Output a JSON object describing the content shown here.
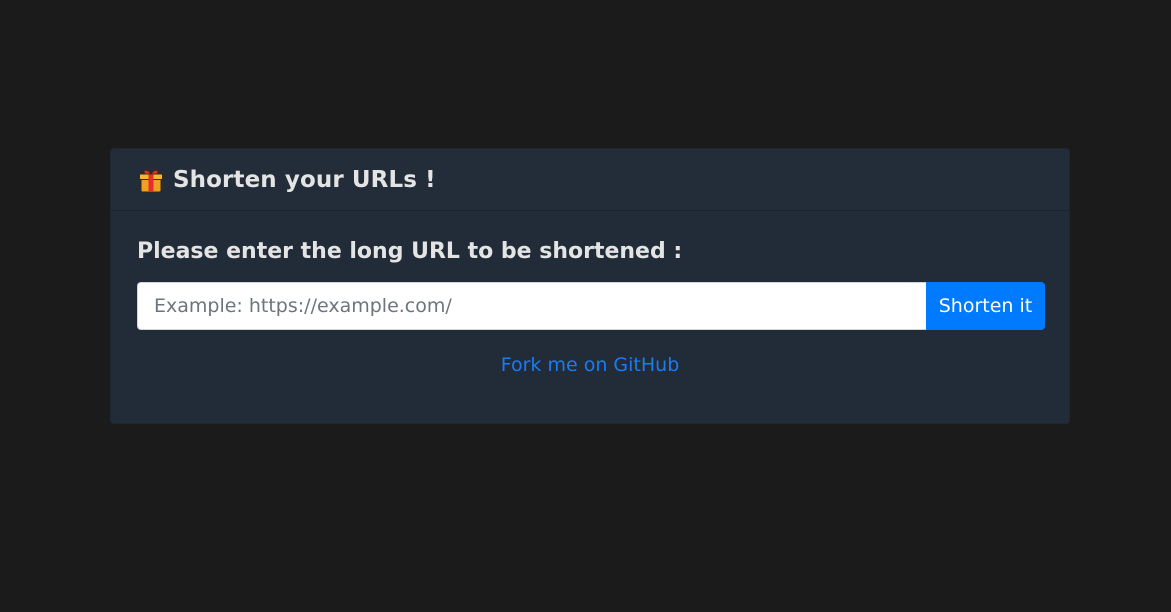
{
  "card": {
    "title": "Shorten your URLs !",
    "title_icon": "gift-icon"
  },
  "form": {
    "prompt": "Please enter the long URL to be shortened :",
    "url_placeholder": "Example: https://example.com/",
    "url_value": "",
    "submit_label": "Shorten it"
  },
  "footer": {
    "github_link": "Fork me on GitHub"
  },
  "colors": {
    "page_background": "#1b1b1b",
    "card_background": "#222b38",
    "button_primary": "#007bff",
    "link": "#1a7cf2",
    "text": "#e4e4e4"
  }
}
